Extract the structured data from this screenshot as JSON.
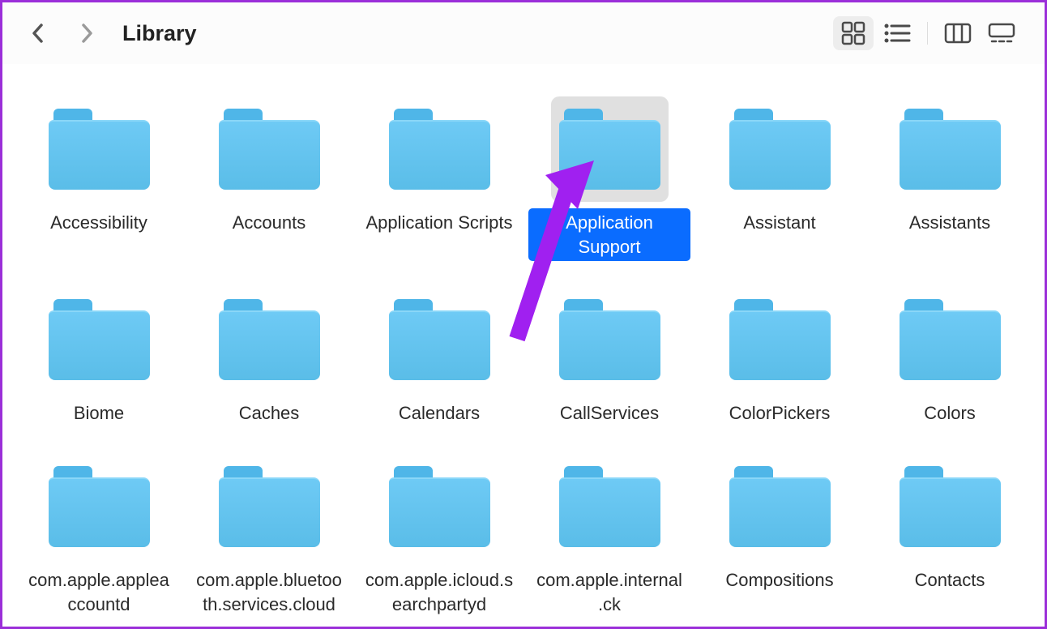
{
  "window": {
    "title": "Library"
  },
  "folders": [
    {
      "name": "Accessibility",
      "selected": false
    },
    {
      "name": "Accounts",
      "selected": false
    },
    {
      "name": "Application Scripts",
      "selected": false
    },
    {
      "name": "Application Support",
      "selected": true
    },
    {
      "name": "Assistant",
      "selected": false
    },
    {
      "name": "Assistants",
      "selected": false
    },
    {
      "name": "Biome",
      "selected": false
    },
    {
      "name": "Caches",
      "selected": false
    },
    {
      "name": "Calendars",
      "selected": false
    },
    {
      "name": "CallServices",
      "selected": false
    },
    {
      "name": "ColorPickers",
      "selected": false
    },
    {
      "name": "Colors",
      "selected": false
    },
    {
      "name": "com.apple.appleaccountd",
      "selected": false
    },
    {
      "name": "com.apple.bluetooth.services.cloud",
      "selected": false
    },
    {
      "name": "com.apple.icloud.searchpartyd",
      "selected": false
    },
    {
      "name": "com.apple.internal.ck",
      "selected": false
    },
    {
      "name": "Compositions",
      "selected": false
    },
    {
      "name": "Contacts",
      "selected": false
    }
  ],
  "view": {
    "active": "icon"
  },
  "annotation": {
    "type": "arrow",
    "color": "#a020f0",
    "target": "Application Support"
  }
}
